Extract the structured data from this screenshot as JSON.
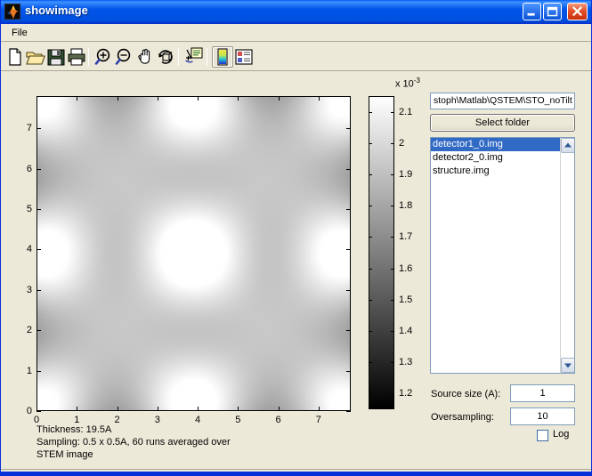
{
  "window": {
    "title": "showimage",
    "app_icon": "matlab-flame-icon",
    "buttons": {
      "minimize": "minimize-icon",
      "maximize": "maximize-icon",
      "close": "close-icon"
    },
    "titlebar_color": "#0054e8",
    "face_color": "#ece9d8"
  },
  "menubar": {
    "items": [
      {
        "label": "File"
      }
    ]
  },
  "toolbar": {
    "items": [
      {
        "name": "new-figure-icon",
        "tooltip": "New Figure",
        "active": false
      },
      {
        "name": "open-file-icon",
        "tooltip": "Open File",
        "active": false
      },
      {
        "name": "save-figure-icon",
        "tooltip": "Save Figure",
        "active": false
      },
      {
        "name": "print-figure-icon",
        "tooltip": "Print Figure",
        "active": false
      },
      {
        "name": "zoom-in-icon",
        "tooltip": "Zoom In",
        "active": false
      },
      {
        "name": "zoom-out-icon",
        "tooltip": "Zoom Out",
        "active": false
      },
      {
        "name": "pan-hand-icon",
        "tooltip": "Pan",
        "active": false
      },
      {
        "name": "rotate-3d-icon",
        "tooltip": "Rotate 3D",
        "active": false
      },
      {
        "name": "insert-legend-icon",
        "tooltip": "Insert Legend",
        "active": false
      },
      {
        "name": "colorbar-icon",
        "tooltip": "Insert Colorbar",
        "active": true
      },
      {
        "name": "plot-browser-icon",
        "tooltip": "Figure Palette",
        "active": false
      }
    ]
  },
  "panel": {
    "path_value": "stoph\\Matlab\\QSTEM\\STO_noTilt",
    "select_folder_label": "Select folder",
    "file_list": [
      {
        "label": "detector1_0.img",
        "selected": true
      },
      {
        "label": "detector2_0.img",
        "selected": false
      },
      {
        "label": "structure.img",
        "selected": false
      }
    ],
    "scrollbar": {
      "up_arrow": "scroll-up-icon",
      "down_arrow": "scroll-down-icon"
    },
    "source_size_label": "Source size (A):",
    "source_size_value": "1",
    "oversampling_label": "Oversampling:",
    "oversampling_value": "10",
    "log_label": "Log",
    "log_checked": false
  },
  "caption": {
    "line1": "Thickness: 19.5A",
    "line2": "Sampling: 0.5 x 0.5A, 60 runs averaged over",
    "line3": "STEM image"
  },
  "chart_data": {
    "type": "heatmap",
    "title": "",
    "xlabel": "",
    "ylabel": "",
    "xticks": [
      0,
      1,
      2,
      3,
      4,
      5,
      6,
      7
    ],
    "yticks": [
      0,
      1,
      2,
      3,
      4,
      5,
      6,
      7
    ],
    "xlim": [
      0,
      7.8
    ],
    "ylim": [
      0,
      7.8
    ],
    "grid": false,
    "colormap": "gray",
    "colorbar": {
      "ticks": [
        1.2,
        1.3,
        1.4,
        1.5,
        1.6,
        1.7,
        1.8,
        1.9,
        2.0,
        2.1
      ],
      "tick_labels": [
        "1.2",
        "1.3",
        "1.4",
        "1.5",
        "1.6",
        "1.7",
        "1.8",
        "1.9",
        "2",
        "2.1"
      ],
      "exponent_label": "x 10",
      "exponent": "-3",
      "clim": [
        0.00115,
        0.00215
      ],
      "position": "right"
    },
    "description": "STEM intensity map of an SrTiO3 lattice: bright atom columns on a square lattice of period 3.9 A, brightest column at the image centre (4,4), weaker columns at the interstitial half-lattice sites.",
    "lattice": {
      "period_a": 3.9,
      "bright_sites": [
        [
          0,
          0
        ],
        [
          3.9,
          0
        ],
        [
          7.8,
          0
        ],
        [
          0,
          3.9
        ],
        [
          3.9,
          3.9
        ],
        [
          7.8,
          3.9
        ],
        [
          0,
          7.8
        ],
        [
          3.9,
          7.8
        ],
        [
          7.8,
          7.8
        ]
      ],
      "weak_sites": [
        [
          1.95,
          1.95
        ],
        [
          5.85,
          1.95
        ],
        [
          1.95,
          5.85
        ],
        [
          5.85,
          5.85
        ]
      ],
      "bright_peak_value": 0.00215,
      "weak_peak_value": 0.00168,
      "background_value": 0.00115
    }
  }
}
